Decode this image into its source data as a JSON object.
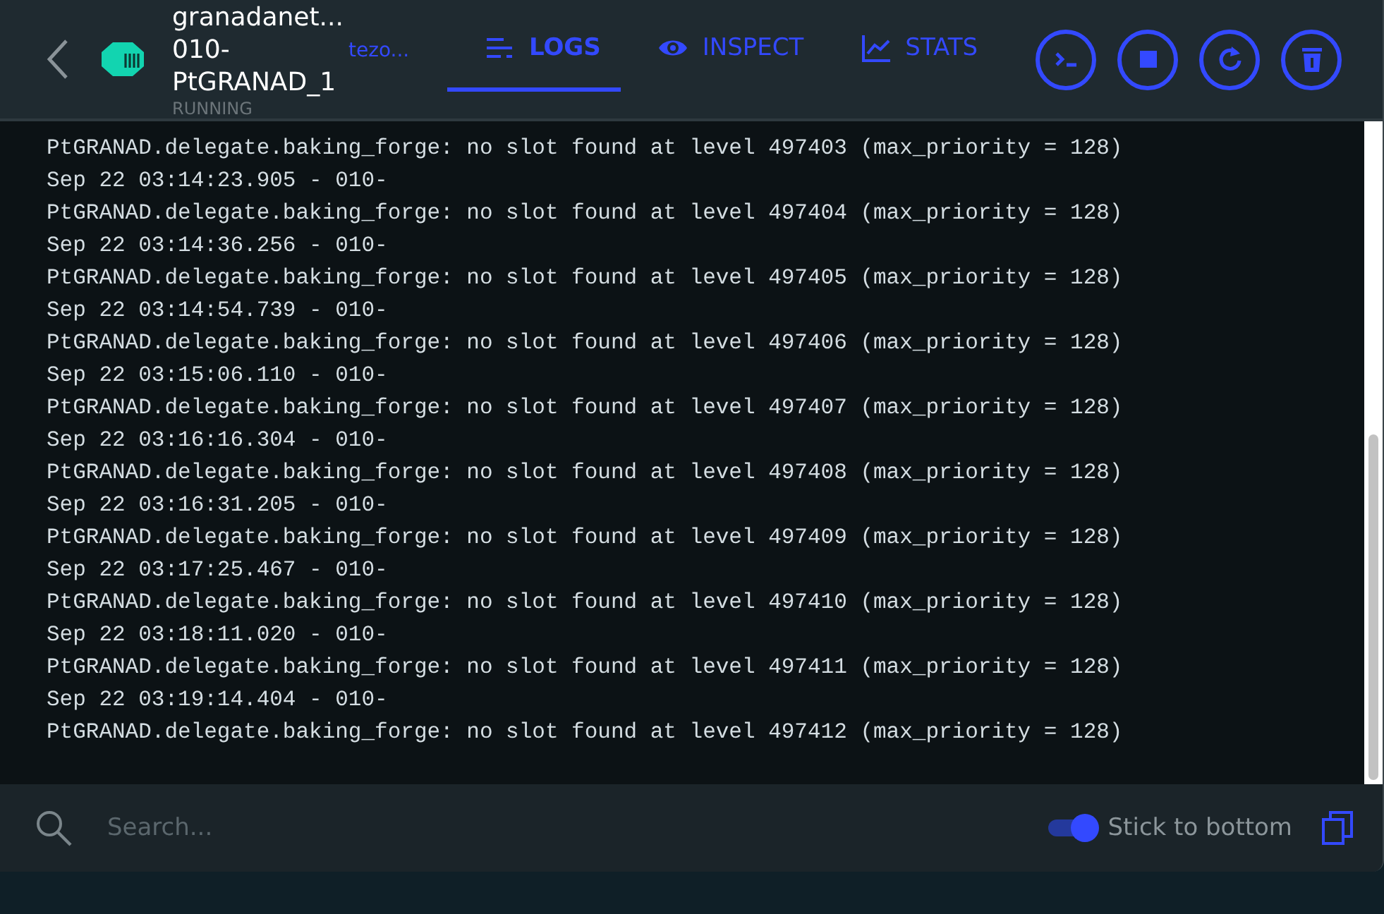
{
  "header": {
    "name_lines": [
      "granadanet...",
      "010-",
      "PtGRANAD_1"
    ],
    "status": "RUNNING",
    "image": "tezo...",
    "tabs": [
      {
        "label": "LOGS",
        "kind": "logs",
        "selected": true
      },
      {
        "label": "INSPECT",
        "kind": "inspect",
        "selected": false
      },
      {
        "label": "STATS",
        "kind": "stats",
        "selected": false
      }
    ],
    "actions": [
      {
        "kind": "cli"
      },
      {
        "kind": "stop"
      },
      {
        "kind": "restart"
      },
      {
        "kind": "delete"
      }
    ]
  },
  "log_lines": [
    "PtGRANAD.delegate.baking_forge: no slot found at level 497403 (max_priority = 128)",
    "Sep 22 03:14:23.905 - 010-",
    "PtGRANAD.delegate.baking_forge: no slot found at level 497404 (max_priority = 128)",
    "Sep 22 03:14:36.256 - 010-",
    "PtGRANAD.delegate.baking_forge: no slot found at level 497405 (max_priority = 128)",
    "Sep 22 03:14:54.739 - 010-",
    "PtGRANAD.delegate.baking_forge: no slot found at level 497406 (max_priority = 128)",
    "Sep 22 03:15:06.110 - 010-",
    "PtGRANAD.delegate.baking_forge: no slot found at level 497407 (max_priority = 128)",
    "Sep 22 03:16:16.304 - 010-",
    "PtGRANAD.delegate.baking_forge: no slot found at level 497408 (max_priority = 128)",
    "Sep 22 03:16:31.205 - 010-",
    "PtGRANAD.delegate.baking_forge: no slot found at level 497409 (max_priority = 128)",
    "Sep 22 03:17:25.467 - 010-",
    "PtGRANAD.delegate.baking_forge: no slot found at level 497410 (max_priority = 128)",
    "Sep 22 03:18:11.020 - 010-",
    "PtGRANAD.delegate.baking_forge: no slot found at level 497411 (max_priority = 128)",
    "Sep 22 03:19:14.404 - 010-",
    "PtGRANAD.delegate.baking_forge: no slot found at level 497412 (max_priority = 128)"
  ],
  "footer": {
    "search": {
      "placeholder": "Search..."
    },
    "stick_to_bottom": {
      "label": "Stick to bottom",
      "on": true
    }
  }
}
